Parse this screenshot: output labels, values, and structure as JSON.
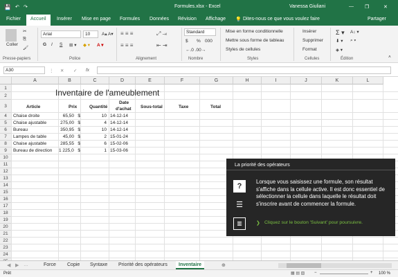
{
  "title": {
    "file": "Formules.xlsx - Excel",
    "user": "Vanessa Giuliani"
  },
  "tabs": [
    "Fichier",
    "Accueil",
    "Insérer",
    "Mise en page",
    "Formules",
    "Données",
    "Révision",
    "Affichage"
  ],
  "tellme": "Dites-nous ce que vous voulez faire",
  "share": "Partager",
  "ribbon": {
    "paste": "Coller",
    "font": "Arial",
    "size": "10",
    "bold": "G",
    "italic": "I",
    "underline": "S",
    "number_format": "Standard",
    "currency": "$",
    "percent": "%",
    "thousands": "000",
    "cond": "Mise en forme conditionnelle",
    "table": "Mettre sous forme de tableau",
    "styles": "Styles de cellules",
    "insert": "Insérer",
    "delete": "Supprimer",
    "format": "Format",
    "groups": {
      "clipboard": "Presse-papiers",
      "font": "Police",
      "alignment": "Alignement",
      "number": "Nombre",
      "styles": "Styles",
      "cells": "Cellules",
      "editing": "Édition"
    }
  },
  "formula_bar": {
    "namebox": "A30",
    "fx": "fx",
    "cancel": "✕",
    "confirm": "✓"
  },
  "columns": [
    "A",
    "B",
    "C",
    "D",
    "E",
    "F",
    "G",
    "H",
    "I",
    "J",
    "K",
    "L"
  ],
  "rows": [
    "1",
    "2",
    "3",
    "4",
    "5",
    "6",
    "7",
    "8",
    "9",
    "10",
    "11",
    "12",
    "13",
    "14",
    "15",
    "16",
    "17",
    "18",
    "19",
    "20",
    "21",
    "22",
    "23",
    "24",
    "25"
  ],
  "sheet": {
    "title": "Inventaire de l'ameublement",
    "headers": {
      "article": "Article",
      "prix": "Prix",
      "quantite": "Quantité",
      "date1": "Date",
      "date2": "d'achat",
      "sous": "Sous-total",
      "taxe": "Taxe",
      "total": "Total"
    },
    "items": [
      {
        "article": "Chaise droite",
        "prix": "65,50",
        "cur": "$",
        "qte": "10",
        "date": "14-12-14"
      },
      {
        "article": "Chaise ajustable",
        "prix": "275,00",
        "cur": "$",
        "qte": "4",
        "date": "14-12-14"
      },
      {
        "article": "Bureau",
        "prix": "350,95",
        "cur": "$",
        "qte": "10",
        "date": "14-12-14"
      },
      {
        "article": "Lampes de table",
        "prix": "45,00",
        "cur": "$",
        "qte": "2",
        "date": "15-01-24"
      },
      {
        "article": "Chaise ajustable",
        "prix": "285,55",
        "cur": "$",
        "qte": "6",
        "date": "15-02-06"
      },
      {
        "article": "Bureau de direction",
        "prix": "1 225,00",
        "cur": "$",
        "qte": "1",
        "date": "15-03-06"
      }
    ]
  },
  "tip": {
    "title": "La priorité des opérateurs",
    "body": "Lorsque vous saisissez une formule, son résultat s'affiche dans la cellule active. Il est donc essentiel de sélectionner la cellule dans laquelle le résultat doit s'inscrire avant de commencer la formule.",
    "next": "Cliquez sur le bouton 'Suivant' pour poursuivre."
  },
  "sheet_tabs": [
    "Force",
    "Copie",
    "Syntaxe",
    "Priorité des opérateurs",
    "Inventaire"
  ],
  "status": {
    "ready": "Prêt",
    "zoom": "100 %"
  },
  "colors": {
    "excel_green": "#217346"
  }
}
